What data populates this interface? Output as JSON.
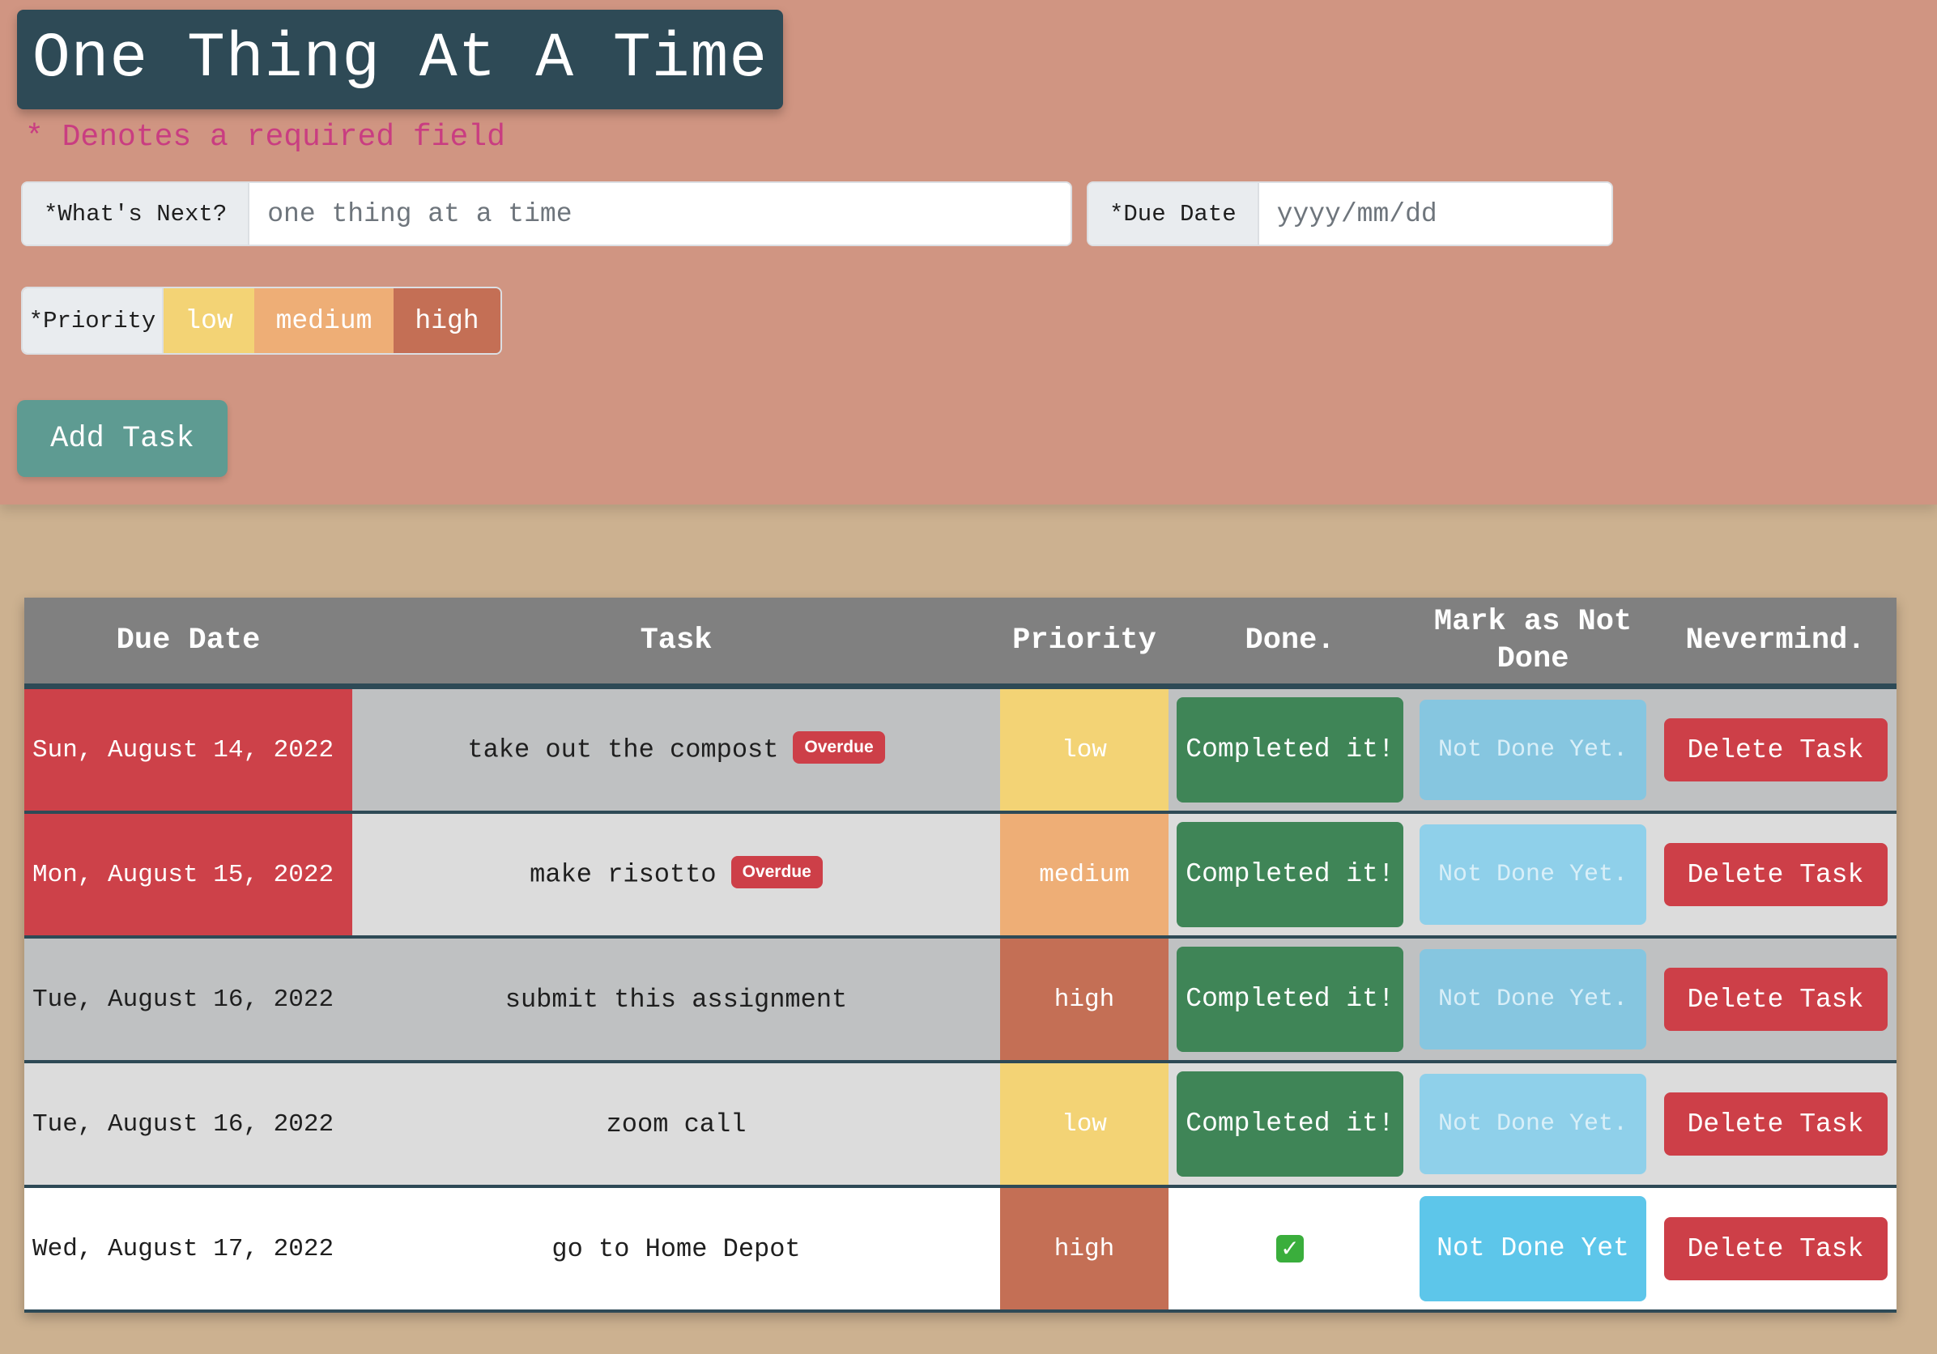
{
  "app": {
    "title": "One Thing At A Time",
    "required_note": "* Denotes a required field"
  },
  "form": {
    "task_label": "*What's Next?",
    "task_placeholder": "one thing at a time",
    "task_value": "",
    "date_label": "*Due Date",
    "date_placeholder": "yyyy/mm/dd",
    "date_value": "",
    "priority_label": "*Priority",
    "priority_options": [
      "low",
      "medium",
      "high"
    ],
    "add_button": "Add Task"
  },
  "table": {
    "headers": [
      "Due Date",
      "Task",
      "Priority",
      "Done.",
      "Mark as Not Done",
      "Nevermind."
    ],
    "rows": [
      {
        "due": "Sun, August 14, 2022",
        "task": "take out the compost",
        "badge": "Overdue",
        "priority": "low",
        "complete_label": "Completed it!",
        "not_done_label": "Not Done Yet.",
        "delete_label": "Delete Task"
      },
      {
        "due": "Mon, August 15, 2022",
        "task": "make risotto",
        "badge": "Overdue",
        "priority": "medium",
        "complete_label": "Completed it!",
        "not_done_label": "Not Done Yet.",
        "delete_label": "Delete Task"
      },
      {
        "due": "Tue, August 16, 2022",
        "task": "submit this assignment",
        "priority": "high",
        "complete_label": "Completed it!",
        "not_done_label": "Not Done Yet.",
        "delete_label": "Delete Task"
      },
      {
        "due": "Tue, August 16, 2022",
        "task": "zoom call",
        "priority": "low",
        "complete_label": "Completed it!",
        "not_done_label": "Not Done Yet.",
        "delete_label": "Delete Task"
      },
      {
        "due": "Wed, August 17, 2022",
        "task": "go to Home Depot",
        "priority": "high",
        "done_icon": "check-mark-icon",
        "not_done_label": "Not Done Yet",
        "delete_label": "Delete Task"
      }
    ]
  },
  "colors": {
    "header_bg": "#d09582",
    "page_bg": "#ccb190",
    "title_bg": "#2e4a56",
    "low": "#f3d375",
    "medium": "#eeae76",
    "high": "#c46f55",
    "overdue": "#cd4149",
    "complete": "#3f8557",
    "not_done": "#5dc6ea",
    "delete": "#cd3f48"
  }
}
